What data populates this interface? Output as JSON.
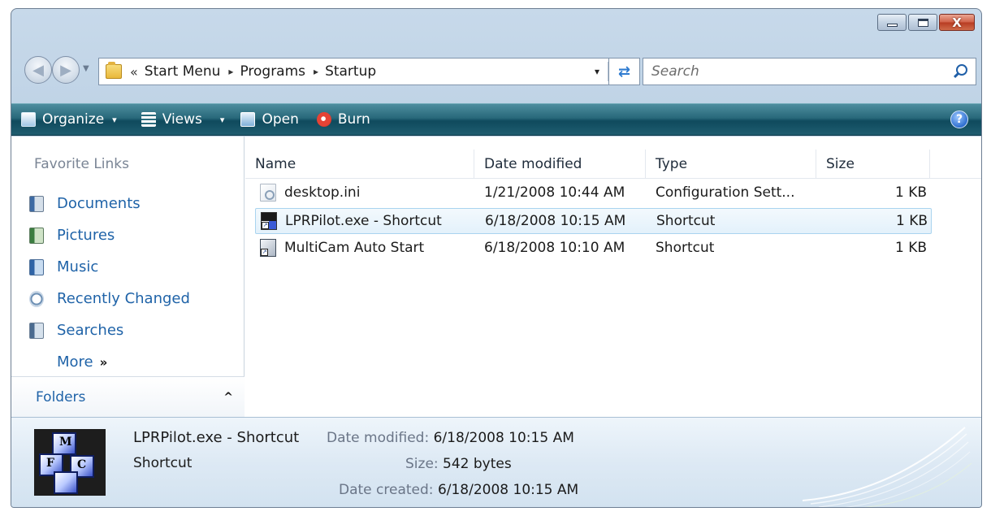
{
  "window": {
    "caption_buttons": {
      "close_glyph": "X"
    }
  },
  "address": {
    "overflow": "«",
    "breadcrumbs": [
      "Start Menu",
      "Programs",
      "Startup"
    ],
    "separator": "▸",
    "dropdown": "▾"
  },
  "search": {
    "placeholder": "Search"
  },
  "toolbar": {
    "organize": "Organize",
    "views": "Views",
    "open": "Open",
    "burn": "Burn",
    "caret": "▾",
    "help": "?"
  },
  "nav_pane": {
    "favorites_title": "Favorite Links",
    "favorites": [
      {
        "label": "Documents",
        "icon": "documents-icon"
      },
      {
        "label": "Pictures",
        "icon": "pictures-icon"
      },
      {
        "label": "Music",
        "icon": "music-icon"
      },
      {
        "label": "Recently Changed",
        "icon": "recently-changed-icon"
      },
      {
        "label": "Searches",
        "icon": "searches-icon"
      }
    ],
    "more": "More",
    "more_chevron": "»",
    "folders": "Folders",
    "folders_caret": "^"
  },
  "file_list": {
    "columns": [
      "Name",
      "Date modified",
      "Type",
      "Size"
    ],
    "rows": [
      {
        "name": "desktop.ini",
        "date": "1/21/2008 10:44 AM",
        "type": "Configuration Sett...",
        "size": "1 KB",
        "icon": "ini-file-icon",
        "selected": false
      },
      {
        "name": "LPRPilot.exe - Shortcut",
        "date": "6/18/2008 10:15 AM",
        "type": "Shortcut",
        "size": "1 KB",
        "icon": "lprpilot-shortcut-icon",
        "selected": true
      },
      {
        "name": "MultiCam Auto Start",
        "date": "6/18/2008 10:10 AM",
        "type": "Shortcut",
        "size": "1 KB",
        "icon": "multicam-shortcut-icon",
        "selected": false
      }
    ]
  },
  "details": {
    "name": "LPRPilot.exe - Shortcut",
    "type": "Shortcut",
    "date_modified_label": "Date modified:",
    "date_modified": "6/18/2008 10:15 AM",
    "size_label": "Size:",
    "size": "542 bytes",
    "date_created_label": "Date created:",
    "date_created": "6/18/2008 10:15 AM",
    "thumbnail_letters": [
      "M",
      "F",
      "C"
    ]
  },
  "colors": {
    "command_bar": "#1f5d70",
    "link_blue": "#1f63a8",
    "selection": "#e3f1fb"
  }
}
